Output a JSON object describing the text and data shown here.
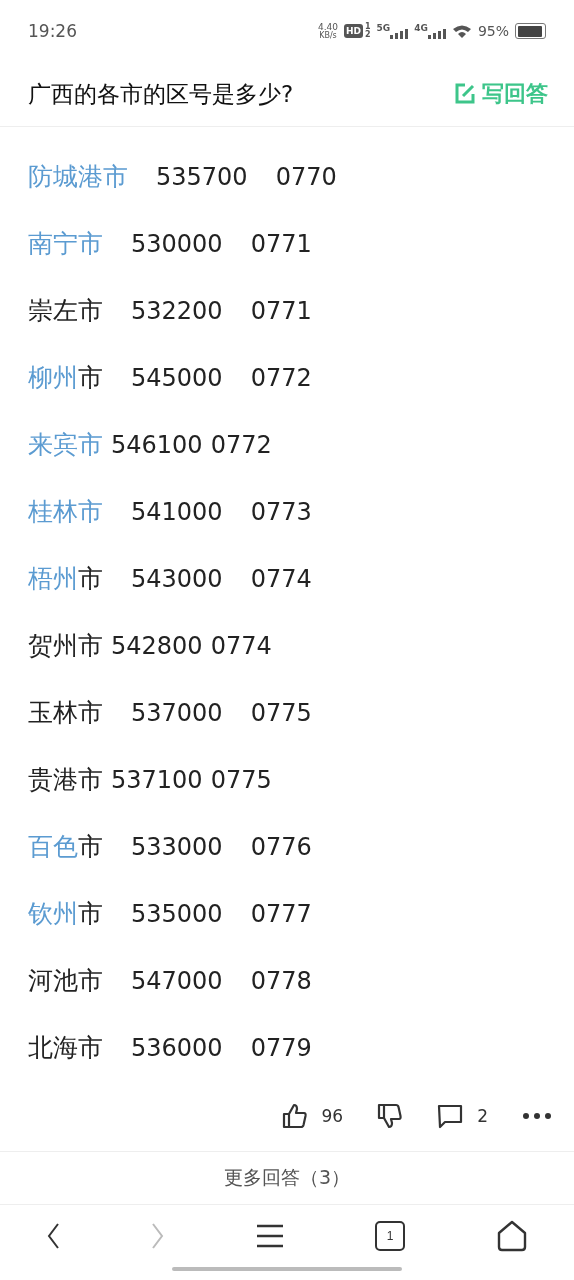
{
  "status_bar": {
    "time": "19:26",
    "speed_value": "4.40",
    "speed_unit": "KB/s",
    "hd": "HD",
    "hd_sims": [
      "1",
      "2"
    ],
    "networks": [
      "5G",
      "4G"
    ],
    "battery": "95%"
  },
  "header": {
    "title": "广西的各市的区号是多少?",
    "answer_button": "写回答"
  },
  "rows": [
    {
      "kind": "spaced",
      "link": "防城港市",
      "name": "",
      "postcode": "535700",
      "code": "0770"
    },
    {
      "kind": "spaced",
      "link": "南宁市",
      "name": "",
      "postcode": "530000",
      "code": "0771"
    },
    {
      "kind": "spaced",
      "link": "",
      "name": "崇左市",
      "postcode": "532200",
      "code": "0771"
    },
    {
      "kind": "spaced",
      "link": "柳州",
      "name": "市",
      "postcode": "545000",
      "code": "0772"
    },
    {
      "kind": "inline",
      "link": "来宾市",
      "name": "",
      "postcode": "546100",
      "code": "0772"
    },
    {
      "kind": "spaced",
      "link": "桂林市",
      "name": "",
      "postcode": "541000",
      "code": "0773"
    },
    {
      "kind": "spaced",
      "link": "梧州",
      "name": "市",
      "postcode": "543000",
      "code": "0774"
    },
    {
      "kind": "inline",
      "link": "",
      "name": "贺州市",
      "postcode": "542800",
      "code": "0774"
    },
    {
      "kind": "spaced",
      "link": "",
      "name": "玉林市",
      "postcode": "537000",
      "code": "0775"
    },
    {
      "kind": "inline",
      "link": "",
      "name": "贵港市",
      "postcode": "537100",
      "code": "0775"
    },
    {
      "kind": "spaced",
      "link": "百色",
      "name": "市",
      "postcode": "533000",
      "code": "0776"
    },
    {
      "kind": "spaced",
      "link": "钦州",
      "name": "市",
      "postcode": "535000",
      "code": "0777"
    },
    {
      "kind": "spaced",
      "link": "",
      "name": "河池市",
      "postcode": "547000",
      "code": "0778"
    },
    {
      "kind": "spaced",
      "link": "",
      "name": "北海市",
      "postcode": "536000",
      "code": "0779"
    }
  ],
  "actions": {
    "likes": "96",
    "comments": "2"
  },
  "more_answers": "更多回答（3）",
  "nav": {
    "forward_disabled": true,
    "tab_count": "1"
  }
}
